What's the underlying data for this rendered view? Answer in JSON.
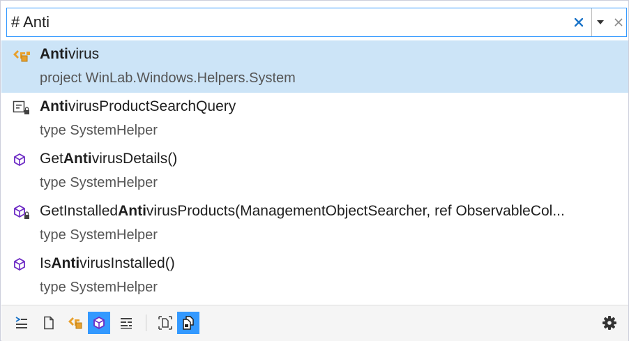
{
  "search": {
    "value": "# Anti",
    "clear_icon": "close-icon",
    "dropdown_icon": "chevron-down-icon",
    "close_icon": "close-icon"
  },
  "results": [
    {
      "icon": "project-icon",
      "pre": "",
      "match": "Anti",
      "post": "virus",
      "subtitle": "project WinLab.Windows.Helpers.System",
      "selected": true
    },
    {
      "icon": "private-field-icon",
      "pre": "",
      "match": "Anti",
      "post": "virusProductSearchQuery",
      "subtitle": "type SystemHelper",
      "selected": false
    },
    {
      "icon": "method-icon",
      "pre": "Get",
      "match": "Anti",
      "post": "virusDetails()",
      "subtitle": "type SystemHelper",
      "selected": false
    },
    {
      "icon": "private-method-icon",
      "pre": "GetInstalled",
      "match": "Anti",
      "post": "virusProducts(ManagementObjectSearcher, ref ObservableCol...",
      "subtitle": "type SystemHelper",
      "selected": false
    },
    {
      "icon": "method-icon",
      "pre": "Is",
      "match": "Anti",
      "post": "virusInstalled()",
      "subtitle": "type SystemHelper",
      "selected": false
    }
  ],
  "toolbar": {
    "filters": [
      {
        "name": "all-items-filter-icon",
        "active": false
      },
      {
        "name": "files-filter-icon",
        "active": false
      },
      {
        "name": "types-filter-icon",
        "active": false
      },
      {
        "name": "members-filter-icon",
        "active": true
      },
      {
        "name": "symbols-filter-icon",
        "active": false
      },
      {
        "name": "current-document-filter-icon",
        "active": false
      },
      {
        "name": "external-items-filter-icon",
        "active": true
      }
    ],
    "settings_icon": "gear-icon"
  },
  "colors": {
    "accent": "#3399ff",
    "selected_row": "#cce4f7",
    "method_purple": "#6c2ac4",
    "project_orange": "#e8a02c",
    "clear_x": "#1a73c8"
  }
}
